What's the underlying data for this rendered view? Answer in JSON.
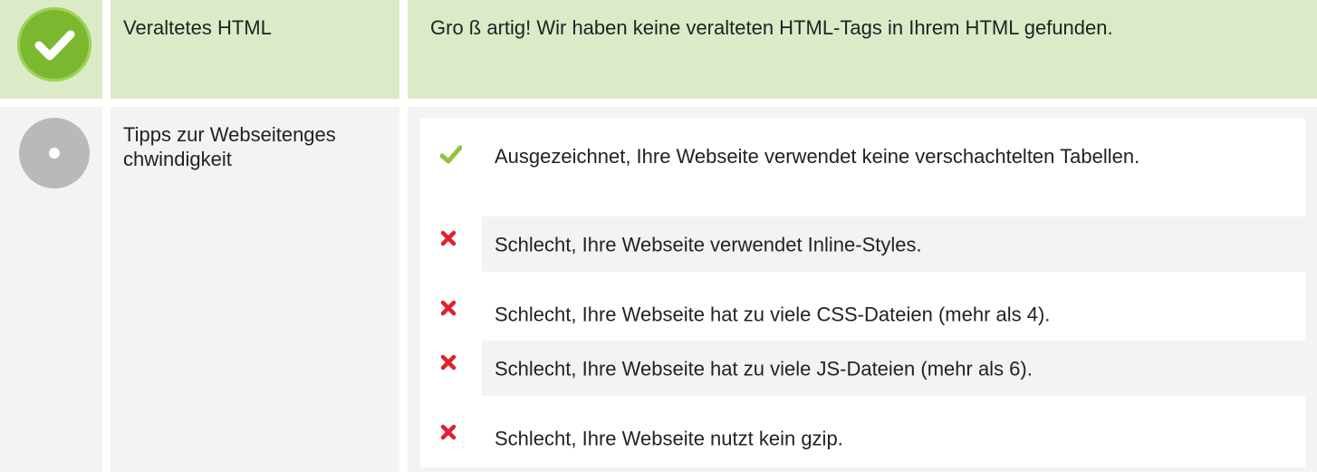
{
  "colors": {
    "pass_row_bg": "#dbebc8",
    "neutral_row_bg": "#f3f3f3",
    "check_green": "#7cb82f",
    "neutral_grey": "#b9b9b9",
    "cross_red": "#e0212b",
    "tick_green": "#8dc63f"
  },
  "deprecated_html": {
    "status_icon": "check-circle-icon",
    "label": "Veraltetes HTML",
    "message": "Gro ß artig! Wir haben keine veralteten HTML-Tags in Ihrem HTML gefunden."
  },
  "speed_tips": {
    "status_icon": "neutral-dot-icon",
    "label": "Tipps zur Webseitenges chwindigkeit",
    "items": [
      {
        "icon": "check-icon",
        "text": "Ausgezeichnet, Ihre Webseite verwendet keine verschachtelten Tabellen."
      },
      {
        "icon": "cross-icon",
        "text": "Schlecht, Ihre Webseite verwendet Inline-Styles."
      },
      {
        "icon": "cross-icon",
        "text": "Schlecht, Ihre Webseite hat zu viele CSS-Dateien (mehr als 4)."
      },
      {
        "icon": "cross-icon",
        "text": "Schlecht, Ihre Webseite hat zu viele JS-Dateien (mehr als 6)."
      },
      {
        "icon": "cross-icon",
        "text": "Schlecht, Ihre Webseite nutzt kein gzip."
      }
    ]
  }
}
